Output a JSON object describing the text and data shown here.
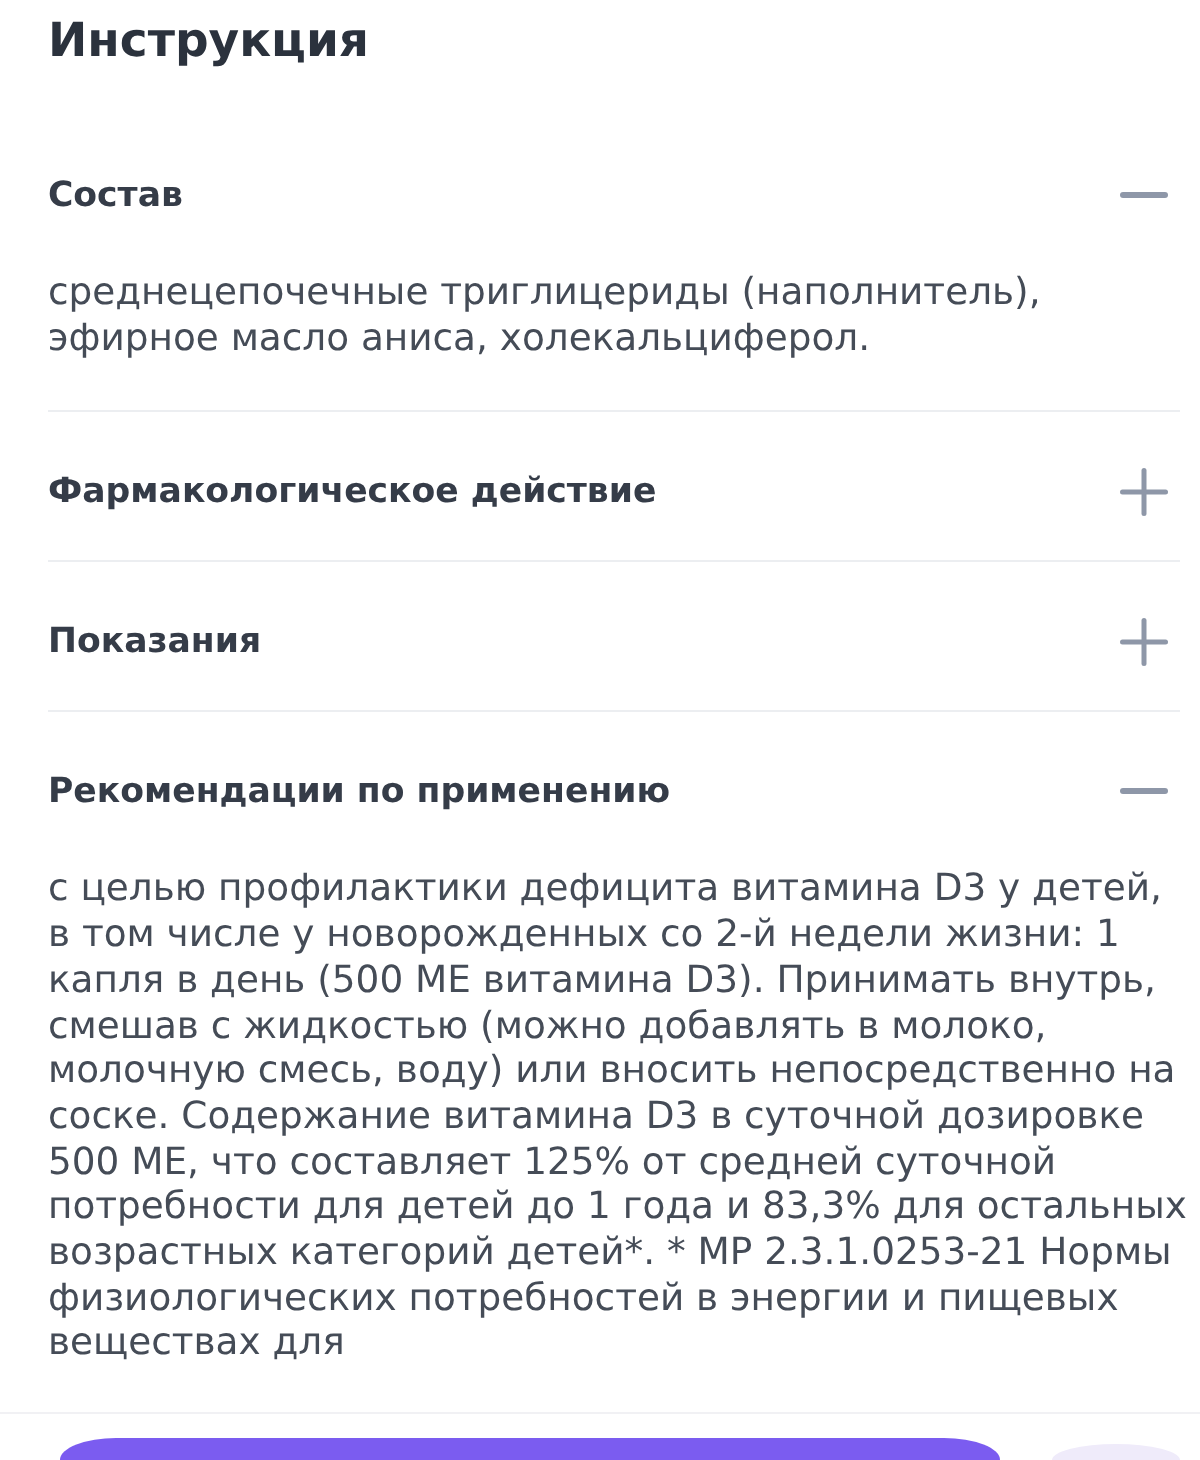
{
  "title": "Инструкция",
  "sections": [
    {
      "title": "Состав",
      "expanded": true,
      "text": "среднецепочечные триглицериды (наполнитель), эфирное масло аниса, холекальциферол."
    },
    {
      "title": "Фармакологическое действие",
      "expanded": false
    },
    {
      "title": "Показания",
      "expanded": false
    },
    {
      "title": "Рекомендации по применению",
      "expanded": true,
      "text": "с целью профилактики дефицита витамина D3 у детей, в том числе у новорожденных со 2-й недели жизни: 1 капля в день (500 МЕ витамина D3). Принимать внутрь, смешав с жидкостью (можно добавлять в молоко, молочную смесь, воду) или вносить непосредственно на соске. Содержание витамина D3 в суточной дозировке 500 МЕ, что составляет 125% от средней суточной потребности для детей до 1 года и 83,3% для остальных возрастных категорий детей*. * МР 2.3.1.0253-21 Нормы физиологических потребностей в энергии и пищевых веществах для"
    }
  ]
}
